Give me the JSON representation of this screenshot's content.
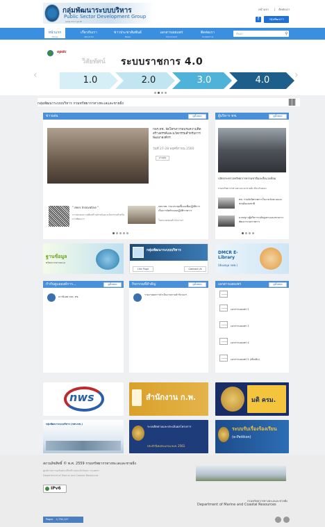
{
  "header": {
    "title_th": "กลุ่มพัฒนาระบบบริหาร",
    "title_en": "Public Sector Development Group",
    "tagline": "psdg.dmcr.go.th",
    "links": [
      "หน้าแรก",
      "ติดต่อเรา"
    ],
    "group_button": "กลุ่มพัฒนาฯ"
  },
  "nav": {
    "items": [
      {
        "label": "หน้าแรก",
        "sub": "Home"
      },
      {
        "label": "เกี่ยวกับเรา",
        "sub": "About Us"
      },
      {
        "label": "ข่าวประชาสัมพันธ์",
        "sub": "News"
      },
      {
        "label": "เอกสารเผยแพร่",
        "sub": "Document"
      },
      {
        "label": "ติดต่อเรา",
        "sub": "Contact Us"
      }
    ],
    "search_placeholder": "ค้นหา"
  },
  "hero": {
    "vision": "วิสัยทัศน์",
    "title": "ระบบราชการ 4.0",
    "steps": [
      "1.0",
      "2.0",
      "3.0",
      "4.0"
    ],
    "step_colors": [
      "#d6eef6",
      "#c2e6f1",
      "#4fb3d9",
      "#1d5f8a"
    ]
  },
  "dept_text": "กลุ่มพัฒนาระบบบริหาร กรมทรัพยากรทางทะเลและชายฝั่ง",
  "panels": {
    "news": {
      "title": "ข่าวเด่น",
      "more": "ดูทั้งหมด",
      "headline": "กพร.ทช. จัดโครงการอบรมความคิดสร้างสรรค์และนวัตกรรมสำหรับการพัฒนาองค์กร",
      "date": "วันที่ 27-28 พฤศจิกายน 2560",
      "read": "อ่านต่อ",
      "item2": "\" สพรร Innovative \"",
      "item2_sub": "การอบรมความคิดสร้างสรรค์และนวัตกรรมสำหรับการพัฒนาฯ",
      "item3": "กพร.ทช. ร่วมประชุมชี้แจงเพื่อปฏิบัติการ เป็นการจัดทำแผนปฏิบัติราชการ",
      "item3_sub": "ในหมวดของสำนักงานฯ"
    },
    "exec": {
      "title": "ผู้บริหาร ทช.",
      "more": "ดูทั้งหมด",
      "caption": "ปลัดกระทรวงทรัพยากรธรรมชาติและสิ่งแวดล้อม",
      "sub": "กรมทรัพยากรทางทะเลและชายฝั่ง ต้อนรับคณะ",
      "item1": "ทช. ร่วมจัดนิทรรศการในงานวันทะเลและชายฝั่งแห่งชาติ",
      "item2": "มาตรฐานผู้บริหารระดับสูงตามแนวทางการพัฒนาระบบราชการ"
    },
    "law": {
      "title": "กำกับดูแลองค์การ...",
      "more": "ดูทั้งหมด",
      "row": "สารนิเทศ กพร. ทช."
    },
    "activity": {
      "title": "กิจกรรมที่สำคัญ",
      "more": "ดูทั้งหมด",
      "row": "รายงานผลการดำเนินงานตามคำรับรองฯ"
    },
    "docs": {
      "title": "เอกสารเผยแพร่",
      "more": "ดูทั้งหมด",
      "rows": [
        "เอกสารเผยแพร่ 2",
        "เอกสารเผยแพร่ 3",
        "เอกสารเผยแพร่ 4",
        "เอกสารเผยแพร่ 5 (เพิ่มเติม)"
      ]
    }
  },
  "banners": {
    "database": "ฐานข้อมูล",
    "database_sub": "ทรัพยากรทางทะเล",
    "fb_title": "กลุ่มพัฒนาระบบบริหาร",
    "fb_like": "Like Page",
    "fb_contact": "Contact Us",
    "library": "DMCR E-Library",
    "library_sub": "(ห้องสมุด กทช.)",
    "nws": "nws",
    "ocsc": "สำนักงาน ก.พ.",
    "cabinet": "มติ ครม.",
    "psdg": "กลุ่มพัฒนาระบบบริหาร (กพร.ทช.)",
    "ppts": "ระบบติดตามและประเมินผลโครงการ",
    "ppts_sub": "ประจำปีงบประมาณ พ.ศ. 2561",
    "epetition": "ระบบรับเรื่องร้องเรียน",
    "epetition_sub": "(e-Petition)"
  },
  "footer": {
    "copyright": "สงวนลิขสิทธิ์ © พ.ศ. 2559 กรมทรัพยากรทางทะเลและชายฝั่ง",
    "address": "ศูนย์ราชการเฉลิมพระเกียรติ ถนนแจ้งวัฒนะ กรุงเทพฯ",
    "dept_en": "Department of Marine and Coastal Resources",
    "ipv6": "IPv6",
    "dept_th_right": "กรมทรัพยากรทางทะเลและชายฝั่ง",
    "dept_en_right": "Department of Marine and Coastal Resources",
    "pages": "Pages",
    "counter": "1,734,127"
  }
}
